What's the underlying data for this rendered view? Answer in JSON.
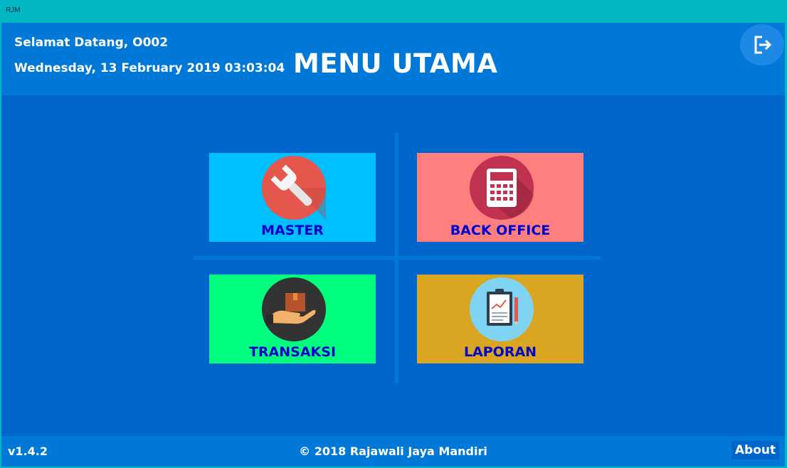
{
  "window": {
    "title": "RJM"
  },
  "header": {
    "welcome": "Selamat Datang, O002",
    "datetime": "Wednesday, 13 February 2019 03:03:04",
    "title": "MENU UTAMA",
    "logout_icon": "logout-icon"
  },
  "menu": {
    "tiles": [
      {
        "label": "MASTER",
        "icon": "wrench-icon",
        "color": "#00bfff"
      },
      {
        "label": "BACK OFFICE",
        "icon": "calculator-icon",
        "color": "#ff7f7f"
      },
      {
        "label": "TRANSAKSI",
        "icon": "package-hand-icon",
        "color": "#00ff7f"
      },
      {
        "label": "LAPORAN",
        "icon": "clipboard-report-icon",
        "color": "#daa520"
      }
    ]
  },
  "footer": {
    "version": "v1.4.2",
    "copyright": "© 2018 Rajawali Jaya Mandiri",
    "about_label": "About"
  },
  "colors": {
    "titlebar": "#00b7c3",
    "background": "#0066cc",
    "header": "#0078d7",
    "label": "#0000cd"
  }
}
